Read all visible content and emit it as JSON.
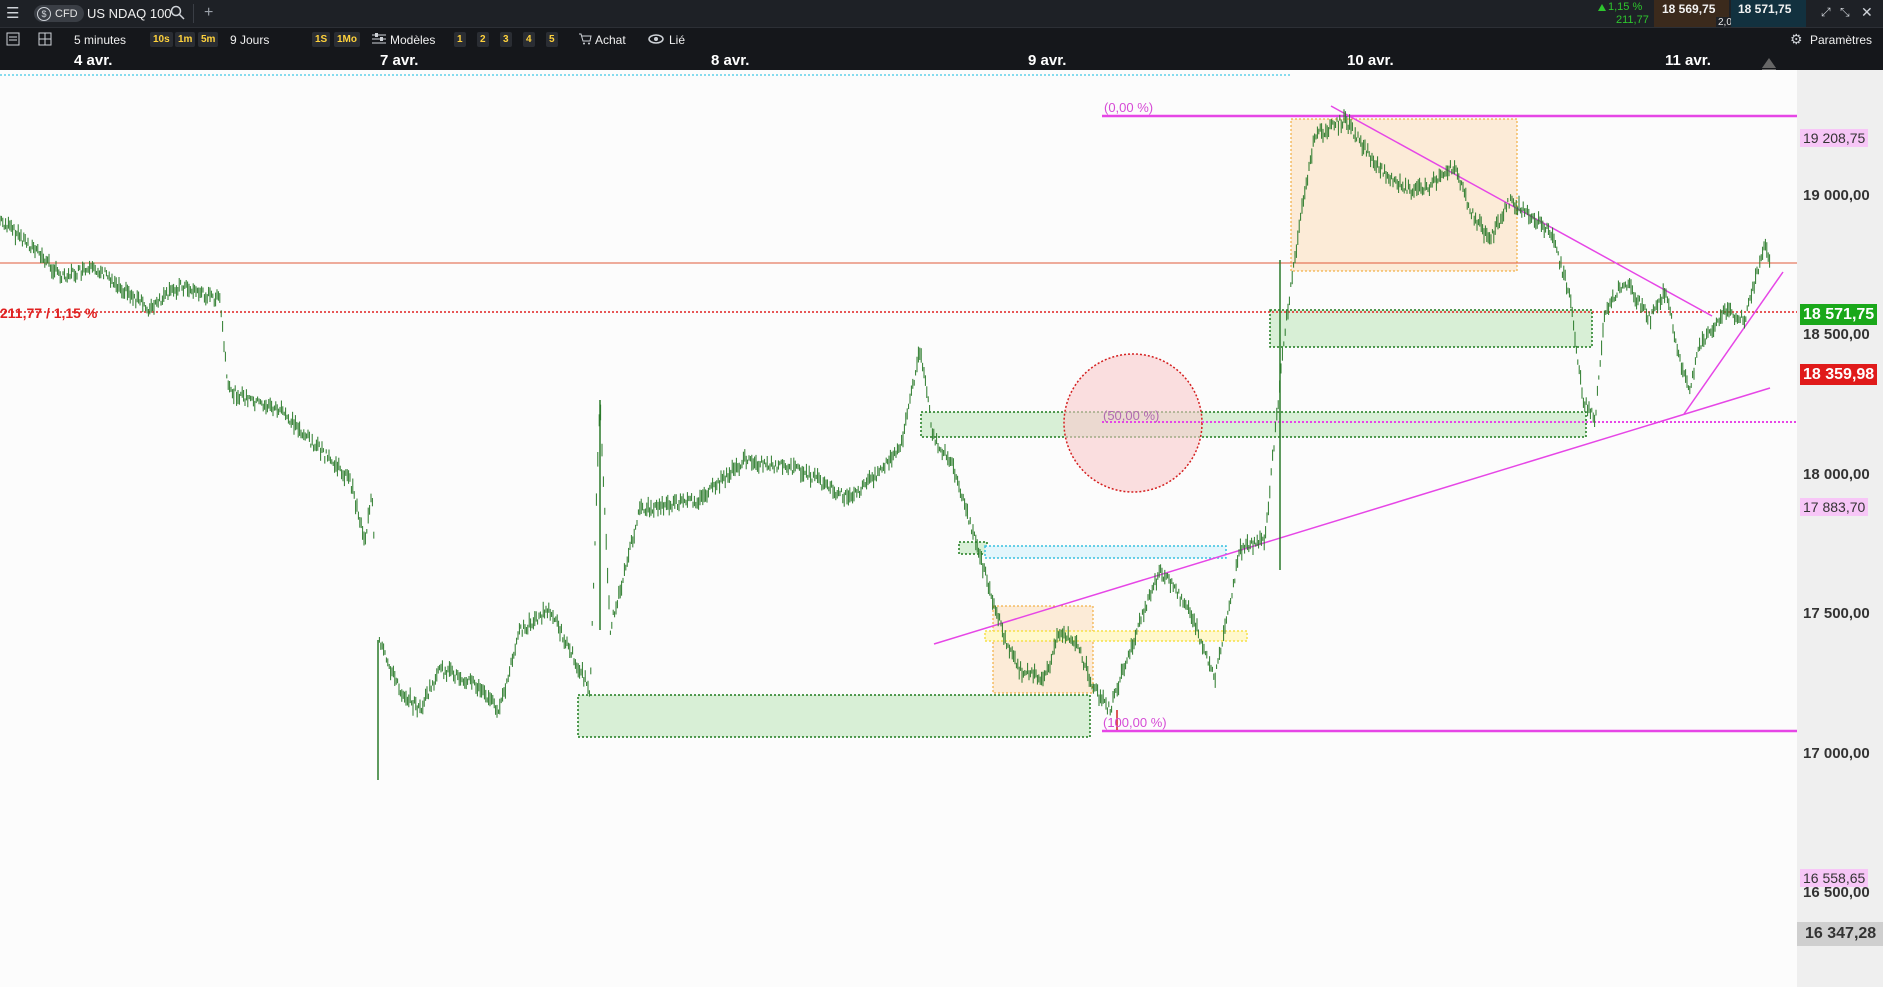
{
  "app": {
    "instrument_type": "CFD",
    "instrument_name": "US NDAQ 100",
    "change_percent": "1,15 %",
    "change_points": "211,77",
    "bid": "18 569,75",
    "spread": "2,00",
    "ask": "18 571,75"
  },
  "toolbar": {
    "timeframe": "5 minutes",
    "tf_buttons": [
      "10s",
      "1m",
      "5m"
    ],
    "period": "9 Jours",
    "period_buttons": [
      "1S",
      "1Mo"
    ],
    "templates_label": "Modèles",
    "template_slots": [
      "1",
      "2",
      "3",
      "4",
      "5"
    ],
    "buy_label": "Achat",
    "link_label": "Lié",
    "settings_label": "Paramètres"
  },
  "dates": [
    "4 avr.",
    "7 avr.",
    "8 avr.",
    "9 avr.",
    "10 avr.",
    "11 avr."
  ],
  "price_axis": [
    "19 000,00",
    "18 500,00",
    "18 000,00",
    "17 500,00",
    "17 000,00",
    "16 500,00"
  ],
  "tags": {
    "fib_top": "19 208,75",
    "current": "18 571,75",
    "prev_close": "18 359,98",
    "fib_mid": "17 883,70",
    "fib_bottom": "16 558,65",
    "low": "16 347,28"
  },
  "annotations": {
    "change_label": "211,77 / 1,15 %",
    "fib_0": "(0,00 %)",
    "fib_50": "(50,00 %)",
    "fib_100": "(100,00 %)"
  },
  "colors": {
    "candles": "#1f7a1f",
    "fib": "#e646e6",
    "current_price": "#1aa81a",
    "prev_close": "#e01a1a"
  }
}
